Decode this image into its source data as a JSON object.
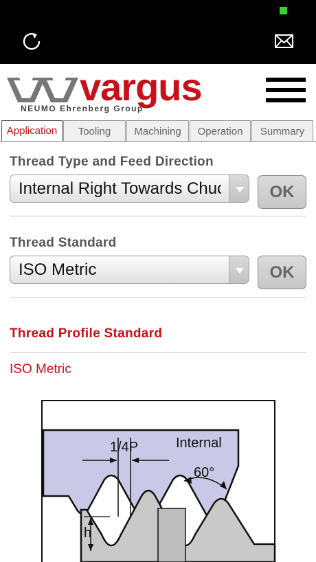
{
  "header": {
    "logo_text": "vargus",
    "logo_subtitle": "NEUMO Ehrenberg Group"
  },
  "tabs": [
    {
      "label": "Application",
      "active": true
    },
    {
      "label": "Tooling",
      "active": false
    },
    {
      "label": "Machining",
      "active": false
    },
    {
      "label": "Operation",
      "active": false
    },
    {
      "label": "Summary",
      "active": false
    }
  ],
  "thread_type": {
    "label": "Thread Type and Feed Direction",
    "value": "Internal Right Towards Chuck",
    "ok_label": "OK"
  },
  "thread_standard": {
    "label": "Thread Standard",
    "value": "ISO Metric",
    "ok_label": "OK"
  },
  "profile": {
    "heading": "Thread Profile Standard",
    "value": "ISO Metric"
  },
  "diagram": {
    "pitch_label": "1/4P",
    "internal_label": "Internal",
    "angle_label": "60°",
    "h_label": "h"
  },
  "colors": {
    "accent": "#c8101a",
    "internal_fill": "#c9c8e6",
    "external_fill": "#c9c9c9"
  }
}
